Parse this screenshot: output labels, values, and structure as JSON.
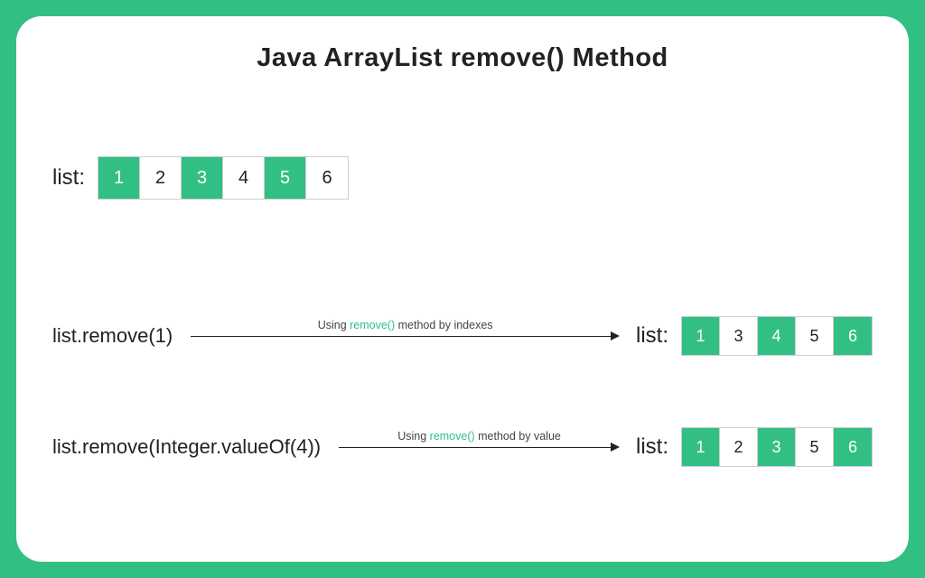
{
  "colors": {
    "accent": "#32bf84"
  },
  "title": "Java ArrayList remove() Method",
  "initial": {
    "label": "list:",
    "values": [
      "1",
      "2",
      "3",
      "4",
      "5",
      "6"
    ],
    "filled": [
      true,
      false,
      true,
      false,
      true,
      false
    ]
  },
  "ex1": {
    "call": "list.remove(1)",
    "cap_pre": "Using ",
    "cap_accent": "remove()",
    "cap_post": " method by indexes",
    "result_label": "list:",
    "values": [
      "1",
      "3",
      "4",
      "5",
      "6"
    ],
    "filled": [
      true,
      false,
      true,
      false,
      true
    ]
  },
  "ex2": {
    "call": "list.remove(Integer.valueOf(4))",
    "cap_pre": "Using ",
    "cap_accent": "remove()",
    "cap_post": " method by value",
    "result_label": "list:",
    "values": [
      "1",
      "2",
      "3",
      "5",
      "6"
    ],
    "filled": [
      true,
      false,
      true,
      false,
      true
    ]
  }
}
